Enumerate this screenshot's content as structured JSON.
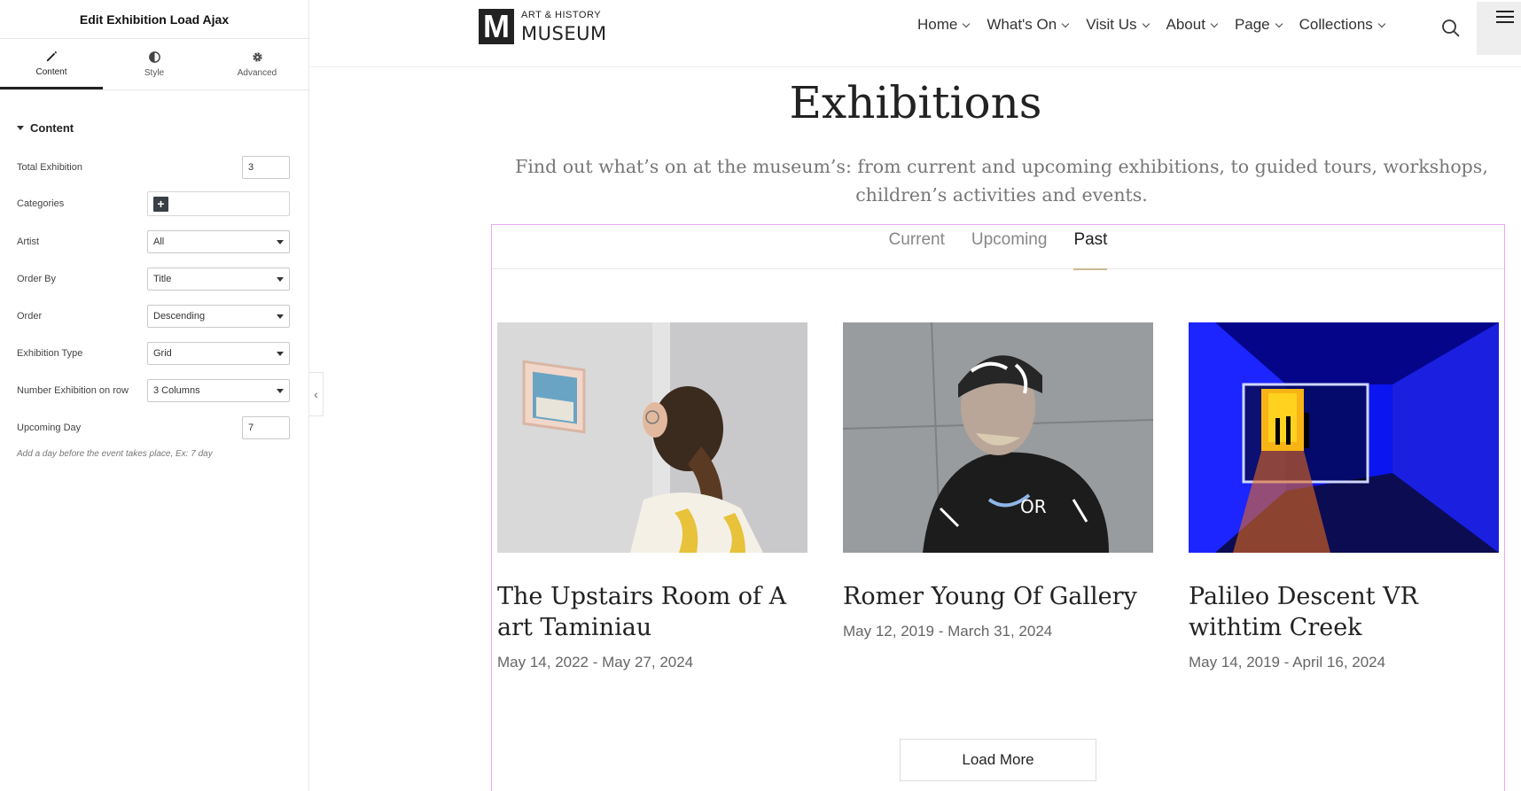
{
  "panel": {
    "title": "Edit Exhibition Load Ajax",
    "tabs": [
      {
        "label": "Content",
        "icon": "pencil-icon",
        "active": true
      },
      {
        "label": "Style",
        "icon": "half-circle-icon",
        "active": false
      },
      {
        "label": "Advanced",
        "icon": "gear-icon",
        "active": false
      }
    ],
    "section_title": "Content",
    "controls": {
      "total_exhibition": {
        "label": "Total Exhibition",
        "value": "3"
      },
      "categories": {
        "label": "Categories"
      },
      "artist": {
        "label": "Artist",
        "value": "All"
      },
      "order_by": {
        "label": "Order By",
        "value": "Title"
      },
      "order": {
        "label": "Order",
        "value": "Descending"
      },
      "exhibition_type": {
        "label": "Exhibition Type",
        "value": "Grid"
      },
      "per_row": {
        "label": "Number Exhibition on row",
        "value": "3 Columns"
      },
      "upcoming_day": {
        "label": "Upcoming Day",
        "value": "7"
      }
    },
    "hint": "Add a day before the event takes place, Ex: 7 day"
  },
  "site": {
    "logo": {
      "mark": "M",
      "small": "ART & HISTORY",
      "big": "MUSEUM"
    },
    "nav": [
      "Home",
      "What's On",
      "Visit Us",
      "About",
      "Page",
      "Collections"
    ],
    "title": "Exhibitions",
    "description": "Find out what’s on at the museum’s: from current and upcoming exhibitions, to guided tours, workshops, children’s activities and events.",
    "tabs": [
      "Current",
      "Upcoming",
      "Past"
    ],
    "active_tab": "Past",
    "cards": [
      {
        "title": "The Upstairs Room of A art Taminiau",
        "date": "May 14, 2022 - May 27, 2024"
      },
      {
        "title": "Romer Young Of Gallery",
        "date": "May 12, 2019 - March 31, 2024"
      },
      {
        "title": "Palileo Descent VR withtim Creek",
        "date": "May 14, 2019 - April 16, 2024"
      }
    ],
    "load_more": "Load More"
  },
  "colors": {
    "widget_outline": "#e9a8ef",
    "active_tab_underline": "#c8b98f",
    "panel_text": "#333333"
  }
}
